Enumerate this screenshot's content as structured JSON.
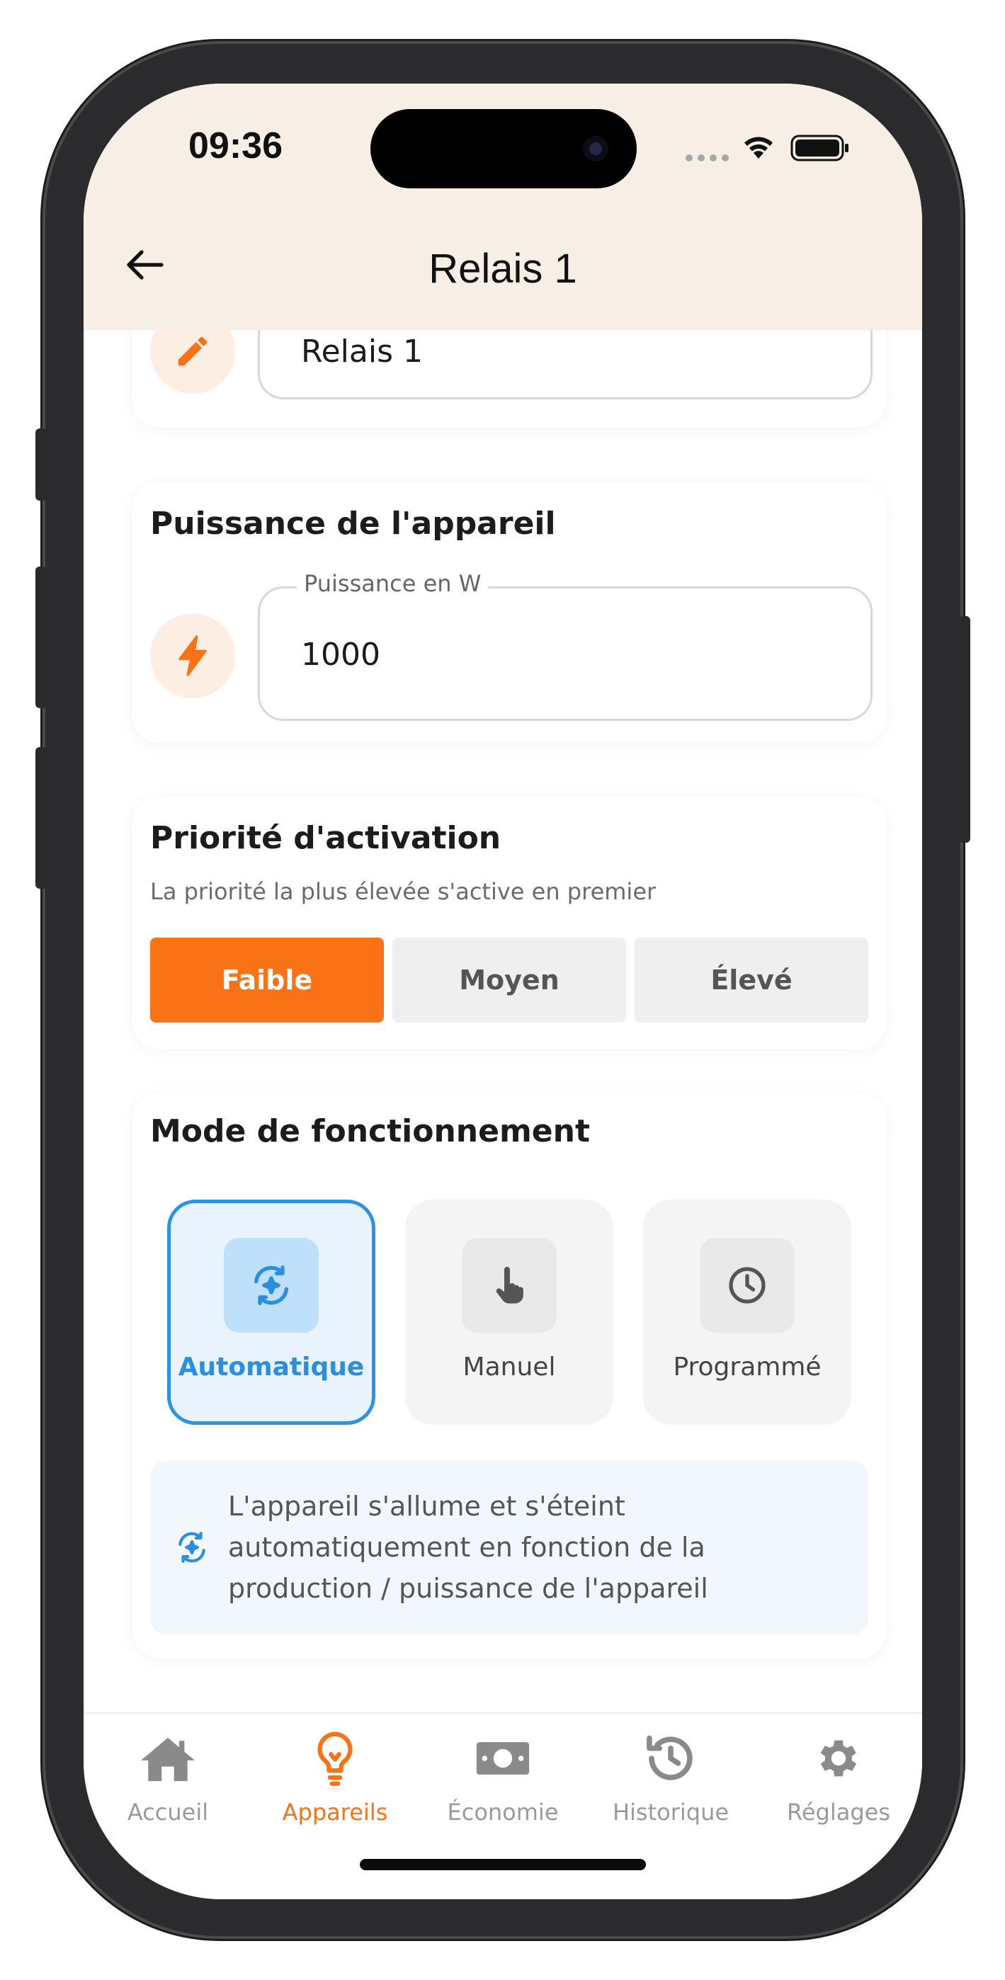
{
  "status_bar": {
    "time": "09:36"
  },
  "header": {
    "title": "Relais 1",
    "back_icon": "arrow-left-icon"
  },
  "name_card": {
    "value": "Relais 1",
    "icon": "pencil-icon"
  },
  "power_card": {
    "title": "Puissance de l'appareil",
    "field_label": "Puissance en W",
    "field_value": "1000",
    "icon": "lightning-bolt-icon"
  },
  "priority_card": {
    "title": "Priorité d'activation",
    "subtitle": "La priorité la plus élevée s'active en premier",
    "options": [
      "Faible",
      "Moyen",
      "Élevé"
    ],
    "selected": "Faible"
  },
  "mode_card": {
    "title": "Mode de fonctionnement",
    "modes": [
      {
        "label": "Automatique",
        "icon": "auto-sparkle-icon"
      },
      {
        "label": "Manuel",
        "icon": "hand-pointer-icon"
      },
      {
        "label": "Programmé",
        "icon": "clock-icon"
      }
    ],
    "selected": "Automatique",
    "description": "L'appareil s'allume et s'éteint automatiquement en fonction de la production / puissance de l'appareil"
  },
  "bottom_nav": {
    "items": [
      {
        "label": "Accueil",
        "icon": "home-icon"
      },
      {
        "label": "Appareils",
        "icon": "lightbulb-icon"
      },
      {
        "label": "Économie",
        "icon": "money-icon"
      },
      {
        "label": "Historique",
        "icon": "history-icon"
      },
      {
        "label": "Réglages",
        "icon": "gear-icon"
      }
    ],
    "active": "Appareils"
  },
  "colors": {
    "accent": "#f97316",
    "selected_blue": "#2a93e6",
    "header_bg": "#f7eee6"
  }
}
